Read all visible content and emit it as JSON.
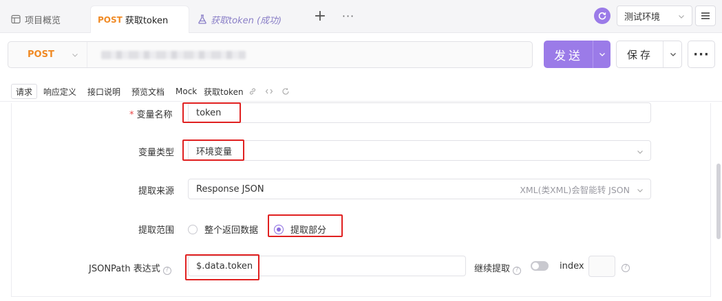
{
  "tabs": [
    {
      "label": "项目概览",
      "icon": "overview-icon"
    },
    {
      "method": "POST",
      "label": "获取token",
      "icon": ""
    },
    {
      "label": "获取token (成功)",
      "icon": "test-case-icon"
    }
  ],
  "tab_bar": {
    "add_label": "+",
    "more_label": "···"
  },
  "environment": {
    "label": "测试环境",
    "icon": "environment-icon"
  },
  "request": {
    "method": "POST",
    "url_redacted": true
  },
  "actions": {
    "send_label": "发送",
    "save_label": "保存",
    "more_label": "···"
  },
  "sub_tabs": [
    "请求",
    "响应定义",
    "接口说明",
    "预览文档",
    "Mock",
    "获取token"
  ],
  "form": {
    "variable_name": {
      "label": "变量名称",
      "required_mark": "*",
      "value": "token"
    },
    "variable_type": {
      "label": "变量类型",
      "value": "环境变量"
    },
    "extract_source": {
      "label": "提取来源",
      "value": "Response JSON",
      "hint": "XML(类XML)会智能转 JSON"
    },
    "extract_scope": {
      "label": "提取范围",
      "options": [
        "整个返回数据",
        "提取部分"
      ],
      "selected": "提取部分"
    },
    "jsonpath": {
      "label": "JSONPath 表达式",
      "value": "$.data.token"
    },
    "continue_extract": {
      "label": "继续提取",
      "enabled": false
    },
    "index": {
      "label": "index",
      "value": ""
    }
  },
  "colors": {
    "accent": "#9b7be8",
    "method": "#f08a24",
    "highlight_box": "#e02020"
  }
}
